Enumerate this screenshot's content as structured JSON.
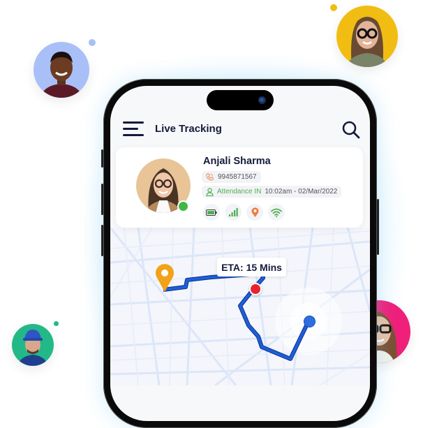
{
  "app": {
    "title": "Live Tracking"
  },
  "employee": {
    "name": "Anjali Sharma",
    "phone": "9945871567",
    "attendance_label": "Attendance IN",
    "attendance_time": "10:02am - 02/Mar/2022",
    "online_status": "online",
    "battery_level": "85%"
  },
  "status_icons": [
    "battery-icon",
    "signal-icon",
    "location-icon",
    "wifi-icon"
  ],
  "map": {
    "eta_label": "ETA: 15 Mins"
  },
  "colors": {
    "primary_text": "#141a3a",
    "route": "#1e5fd8",
    "pin": "#f2a219",
    "current_location": "#e8232e",
    "destination": "#2e6fe0",
    "online": "#43b649",
    "attendance": "#4caf50",
    "phone_icon": "#f27a3c",
    "avatar_blue_bg": "#a9bff7",
    "avatar_yellow_bg": "#f2bd12",
    "avatar_pink_bg": "#ef1f7a",
    "avatar_green_bg": "#23b887"
  },
  "floating_avatars": [
    "avatar-man-blue",
    "avatar-woman-yellow",
    "avatar-woman-pink",
    "avatar-man-green"
  ]
}
